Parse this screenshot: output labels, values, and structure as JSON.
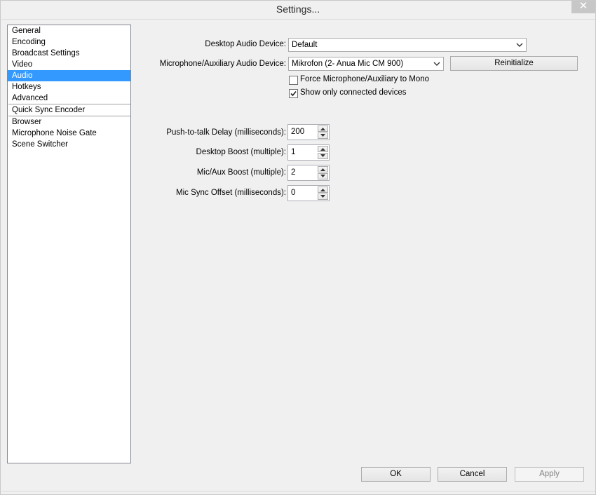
{
  "window": {
    "title": "Settings...",
    "close_glyph": "✕"
  },
  "sidebar": {
    "items": [
      {
        "label": "General"
      },
      {
        "label": "Encoding"
      },
      {
        "label": "Broadcast Settings"
      },
      {
        "label": "Video"
      },
      {
        "label": "Audio",
        "selected": true
      },
      {
        "label": "Hotkeys"
      },
      {
        "label": "Advanced"
      },
      {
        "label": "Quick Sync Encoder"
      },
      {
        "label": "Browser"
      },
      {
        "label": "Microphone Noise Gate"
      },
      {
        "label": "Scene Switcher"
      }
    ]
  },
  "audio": {
    "desktop_device_label": "Desktop Audio Device:",
    "desktop_device_value": "Default",
    "mic_device_label": "Microphone/Auxiliary Audio Device:",
    "mic_device_value": "Mikrofon (2- Anua Mic CM 900)",
    "reinitialize_label": "Reinitialize",
    "force_mono_label": "Force Microphone/Auxiliary to Mono",
    "force_mono_checked": false,
    "connected_only_label": "Show only connected devices",
    "connected_only_checked": true,
    "ptt_delay_label": "Push-to-talk Delay (milliseconds):",
    "ptt_delay_value": "200",
    "desktop_boost_label": "Desktop Boost (multiple):",
    "desktop_boost_value": "1",
    "mic_boost_label": "Mic/Aux Boost (multiple):",
    "mic_boost_value": "2",
    "mic_sync_label": "Mic Sync Offset (milliseconds):",
    "mic_sync_value": "0"
  },
  "footer": {
    "ok_label": "OK",
    "cancel_label": "Cancel",
    "apply_label": "Apply"
  },
  "icons": {
    "close": "close-icon",
    "dropdown": "chevron-down-icon",
    "spin_up": "spin-up-arrow-icon",
    "spin_down": "spin-down-arrow-icon",
    "checkmark": "checkmark-icon"
  },
  "colors": {
    "selection": "#3399ff",
    "window_bg": "#f0f0f0",
    "close_button": "#c7c7c7"
  }
}
